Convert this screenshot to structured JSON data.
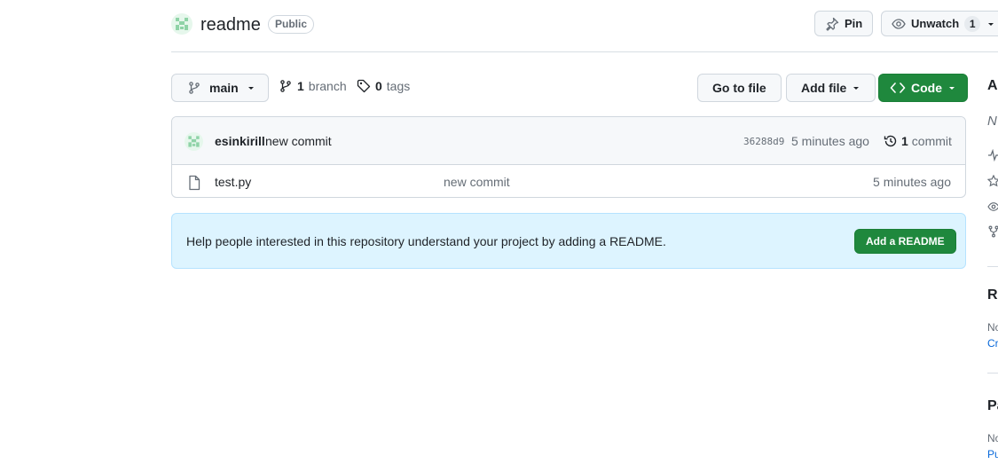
{
  "repo": {
    "name": "readme",
    "visibility": "Public"
  },
  "header_actions": {
    "pin_label": "Pin",
    "unwatch_label": "Unwatch",
    "watch_count": "1"
  },
  "branch_bar": {
    "current_branch": "main",
    "branch_count": "1",
    "branch_word": "branch",
    "tag_count": "0",
    "tag_word": "tags",
    "goto_file_label": "Go to file",
    "add_file_label": "Add file",
    "code_label": "Code"
  },
  "latest_commit": {
    "author": "esinkirill",
    "message": "new commit",
    "sha": "36288d9",
    "time": "5 minutes ago",
    "count": "1",
    "count_word": "commit"
  },
  "files": [
    {
      "name": "test.py",
      "commit_message": "new commit",
      "time": "5 minutes ago"
    }
  ],
  "readme_banner": {
    "text": "Help people interested in this repository understand your project by adding a README.",
    "button_label": "Add a README"
  },
  "sidebar_clipped": {
    "about_heading": "A",
    "about_desc": "N",
    "releases_heading": "Re",
    "releases_none": "No",
    "releases_link": "Cr",
    "packages_heading": "Pa",
    "packages_none": "No",
    "packages_link": "Pu"
  },
  "colors": {
    "primary_green": "#1f883d",
    "banner_bg": "#ddf4ff",
    "link_blue": "#0969da"
  }
}
